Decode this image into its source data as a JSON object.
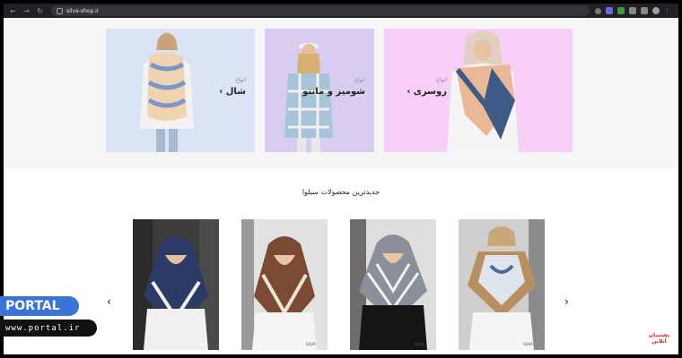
{
  "browser": {
    "url": "silva-shop.ir",
    "back": "←",
    "forward": "→",
    "reload": "↻"
  },
  "banners": [
    {
      "small": "انواع",
      "title": "شال",
      "chevron": "›",
      "bg": "#dbe4f4"
    },
    {
      "small": "انواع",
      "title": "شومیز و مانتو",
      "chevron": "›",
      "bg": "#d8cdf0"
    },
    {
      "small": "انواع",
      "title": "روسری",
      "chevron": "›",
      "bg": "#f8cff6"
    }
  ],
  "section": {
    "title": "جدیدترین محصولات سیلوا"
  },
  "carousel": {
    "prev": "‹",
    "next": "›"
  },
  "products": [
    {
      "brand": "SILVA",
      "scarf": "#2c3b66"
    },
    {
      "brand": "SILVA",
      "scarf": "#7a4a35"
    },
    {
      "brand": "SILVA",
      "scarf": "#5a5f6b"
    },
    {
      "brand": "SILVA",
      "scarf": "#b89060"
    }
  ],
  "watermark": {
    "label": "PORTAL",
    "url": "www.portal.ir"
  },
  "corner_logo": {
    "line1": "پشتیبان",
    "line2": "آنلاین"
  }
}
